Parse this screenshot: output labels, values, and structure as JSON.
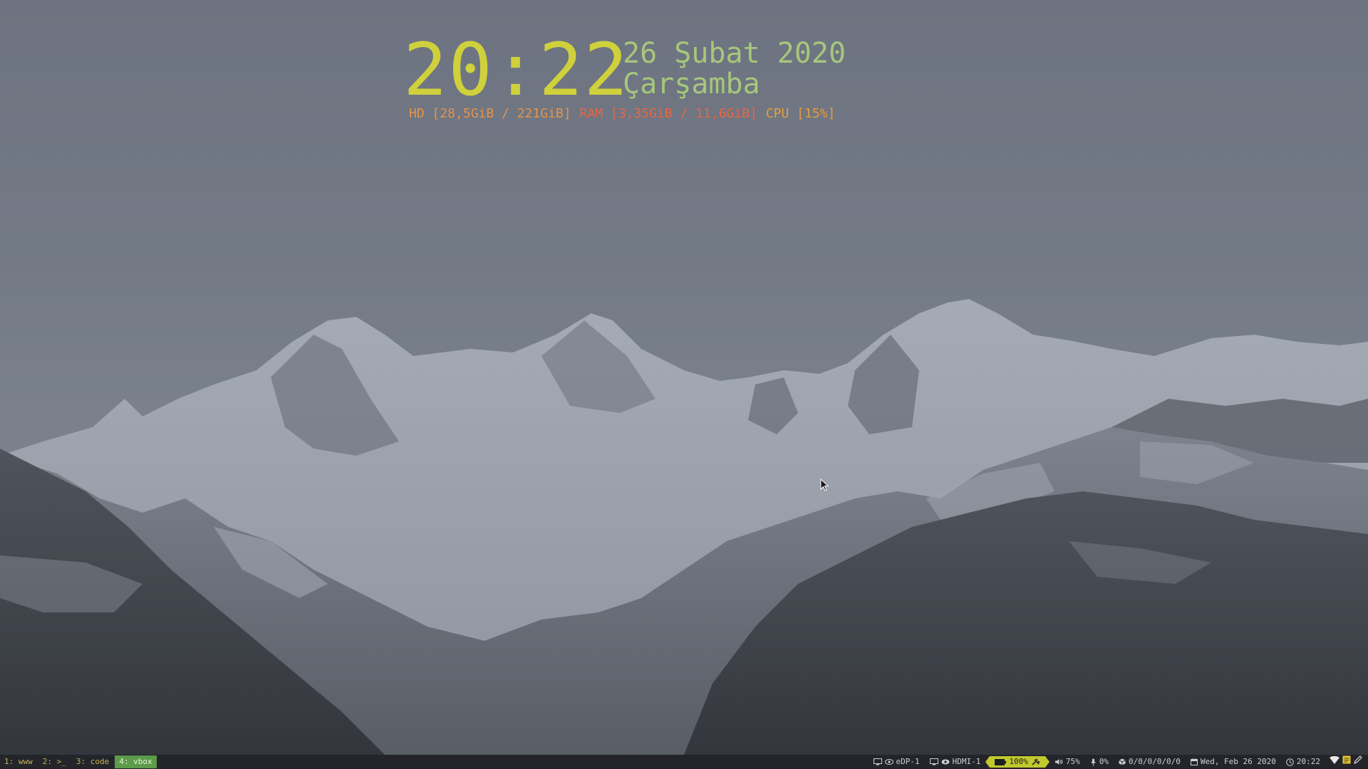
{
  "conky": {
    "time": "20:22",
    "date": "26 Şubat 2020",
    "weekday": "Çarşamba",
    "hd": "HD [28,5GiB / 221GiB]",
    "ram": "RAM [3,35GiB / 11,6GiB]",
    "cpu": "CPU [15%]"
  },
  "bar": {
    "workspaces": [
      {
        "label": "1: www",
        "focused": false
      },
      {
        "label": "2: >_",
        "focused": false
      },
      {
        "label": "3: code",
        "focused": false
      },
      {
        "label": "4: vbox",
        "focused": true
      }
    ],
    "status": {
      "display1": "eDP-1",
      "display2": "HDMI-1",
      "battery": "100%",
      "volume": "75%",
      "mic": "0%",
      "updates": "0/0/0/0/0/0",
      "date": "Wed, Feb 26 2020",
      "time": "20:22"
    }
  },
  "colors": {
    "clock": "#cfd13c",
    "date": "#a5c77b",
    "hd": "#e5944a",
    "ram": "#ea6542",
    "cpu": "#e89c3a",
    "bar_bg": "#23252a",
    "workspace_focused": "#5d9b4b",
    "battery_bg": "#c1c92c"
  },
  "icons": {
    "display": "monitor-icon",
    "projector": "eye-icon",
    "battery": "battery-icon",
    "plug": "plug-icon",
    "volume": "speaker-icon",
    "mic": "microphone-icon",
    "updates": "package-icon",
    "calendar": "calendar-icon",
    "clock": "clock-icon",
    "wifi": "wifi-icon",
    "notes": "notes-icon",
    "pen": "pen-icon"
  }
}
